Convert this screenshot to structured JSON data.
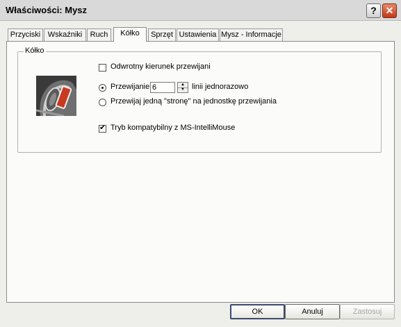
{
  "window": {
    "title": "Właściwości: Mysz",
    "help_label": "?",
    "close_label": "✕"
  },
  "tabs": [
    {
      "label": "Przyciski"
    },
    {
      "label": "Wskaźniki"
    },
    {
      "label": "Ruch"
    },
    {
      "label": "Kółko",
      "active": true
    },
    {
      "label": "Sprzęt"
    },
    {
      "label": "Ustawienia"
    },
    {
      "label": "Mysz - Informacje"
    }
  ],
  "wheel": {
    "group_label": "Kółko",
    "reverse": {
      "label": "Odwrotny kierunek przewijani",
      "checked": false
    },
    "scroll_lines": {
      "label": "Przewijanie",
      "value": "6",
      "suffix": "linii jednorazowo",
      "selected": true
    },
    "scroll_page": {
      "label": "Przewijaj jedną \"stronę\" na jednostkę przewijania",
      "selected": false
    },
    "intellimouse": {
      "label": "Tryb kompatybilny z MS-IntelliMouse",
      "checked": true
    }
  },
  "buttons": {
    "ok": "OK",
    "cancel": "Anuluj",
    "apply": "Zastosuj"
  },
  "check_glyph": "✔"
}
